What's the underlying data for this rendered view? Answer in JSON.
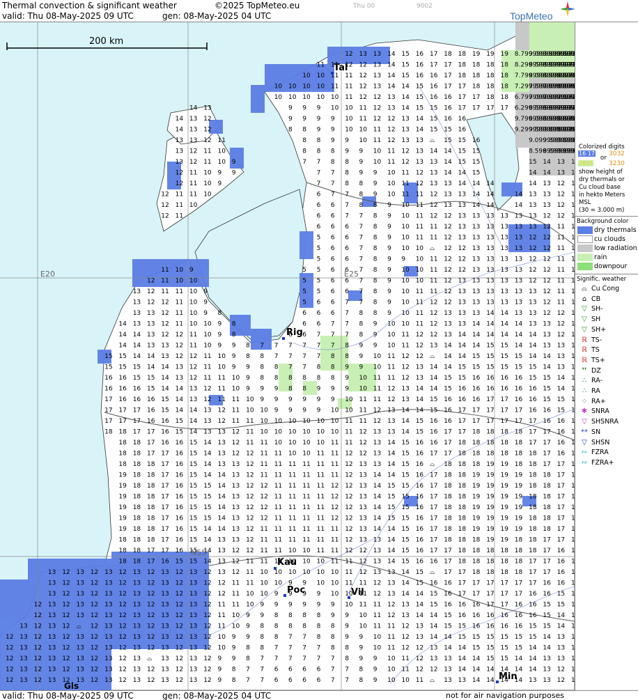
{
  "header": {
    "title": "Thermal convection & significant weather",
    "copyright": "©2025 TopMeteo.eu",
    "valid": "valid:  Thu  08-May-2025  09 UTC",
    "gen": "gen: 08-May-2025 04 UTC",
    "faint_day": "Thu 00",
    "faint_code": "9002",
    "logo": "TopMeteo"
  },
  "scale": {
    "label": "200 km"
  },
  "grid_labels": {
    "lon20": "E20",
    "lon25": "E25",
    "lat55": "N55"
  },
  "cities": [
    {
      "name": "Tal"
    },
    {
      "name": "Rig"
    },
    {
      "name": "Kau"
    },
    {
      "name": "Poc"
    },
    {
      "name": "Vil"
    },
    {
      "name": "Gls"
    },
    {
      "name": "Min"
    }
  ],
  "legend": {
    "colorized_title": "Colorized digits",
    "sample1": "16 17",
    "sample2": "3032",
    "or": "or",
    "sample3": "2825",
    "sample4": "3230",
    "desc1": "show height of",
    "desc2": "dry thermals or",
    "desc3": "Cu cloud base",
    "desc4": "in hekto Meters",
    "desc5": "MSL",
    "desc6": "(30 = 3.000 m)",
    "bg_title": "Background color",
    "bg_items": [
      {
        "label": "dry thermals",
        "color": "#5b7ee5"
      },
      {
        "label": "cu clouds",
        "color": "#ffffff"
      },
      {
        "label": "low radiation",
        "color": "#c8c8c8"
      },
      {
        "label": "rain",
        "color": "#c9f0b4"
      },
      {
        "label": "downpour",
        "color": "#8ee07a"
      }
    ],
    "sig_title": "Signific. weather",
    "sig_items": [
      {
        "label": "Cu Cong",
        "icon": "cu-cong-icon",
        "glyph": "⌓",
        "color": "#000000"
      },
      {
        "label": "CB",
        "icon": "cb-icon",
        "glyph": "⌂",
        "color": "#000000"
      },
      {
        "label": "SH-",
        "icon": "sh-light-icon",
        "glyph": "▽",
        "color": "#2a9a2a"
      },
      {
        "label": "SH",
        "icon": "sh-icon",
        "glyph": "▽",
        "color": "#2a9a2a"
      },
      {
        "label": "SH+",
        "icon": "sh-heavy-icon",
        "glyph": "▽",
        "color": "#2a9a2a"
      },
      {
        "label": "TS-",
        "icon": "ts-light-icon",
        "glyph": "ℝ",
        "color": "#d02020"
      },
      {
        "label": "TS",
        "icon": "ts-icon",
        "glyph": "ℝ",
        "color": "#d02020"
      },
      {
        "label": "TS+",
        "icon": "ts-heavy-icon",
        "glyph": "ℝ",
        "color": "#d02020"
      },
      {
        "label": "DZ",
        "icon": "drizzle-icon",
        "glyph": "❜❜",
        "color": "#1a7a1a"
      },
      {
        "label": "RA-",
        "icon": "rain-light-icon",
        "glyph": "∴",
        "color": "#1a7a1a"
      },
      {
        "label": "RA",
        "icon": "rain-icon",
        "glyph": "∴",
        "color": "#1a7a1a"
      },
      {
        "label": "RA+",
        "icon": "rain-heavy-icon",
        "glyph": "⁘",
        "color": "#1a7a1a"
      },
      {
        "label": "SNRA",
        "icon": "snow-rain-icon",
        "glyph": "✱",
        "color": "#c040c0"
      },
      {
        "label": "SHSNRA",
        "icon": "shower-snow-rain-icon",
        "glyph": "▽",
        "color": "#c040c0"
      },
      {
        "label": "SN",
        "icon": "snow-icon",
        "glyph": "**",
        "color": "#2040c0"
      },
      {
        "label": "SHSN",
        "icon": "shower-snow-icon",
        "glyph": "▽",
        "color": "#2040c0"
      },
      {
        "label": "FZRA",
        "icon": "freezing-rain-icon",
        "glyph": "∾",
        "color": "#20b0c0"
      },
      {
        "label": "FZRA+",
        "icon": "freezing-rain-heavy-icon",
        "glyph": "∾",
        "color": "#20b0c0"
      }
    ]
  },
  "footer": {
    "valid": "valid:  Thu  08-May-2025  09 UTC",
    "gen": "gen: 08-May-2025 04 UTC",
    "disclaimer": "not for air navigation purposes"
  }
}
